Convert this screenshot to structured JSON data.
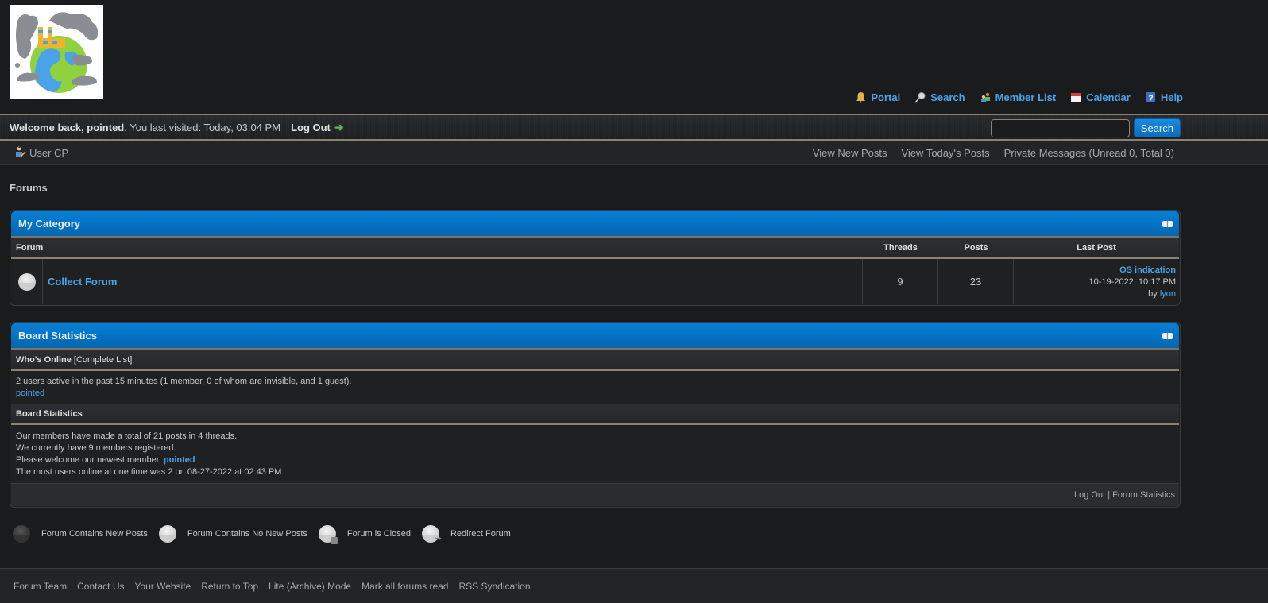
{
  "header": {
    "logo_alt": "earth-pollution-logo",
    "menu": [
      {
        "label": "Portal",
        "icon": "bell-icon"
      },
      {
        "label": "Search",
        "icon": "magnifier-icon"
      },
      {
        "label": "Member List",
        "icon": "members-icon"
      },
      {
        "label": "Calendar",
        "icon": "calendar-icon"
      },
      {
        "label": "Help",
        "icon": "help-icon"
      }
    ]
  },
  "welcome": {
    "greeting": "Welcome back, pointed",
    "last_visit": ". You last visited: Today, 03:04 PM",
    "logout_label": "Log Out",
    "search_placeholder": "",
    "search_value": "",
    "search_button": "Search"
  },
  "usercp": {
    "label": "User CP",
    "links": [
      "View New Posts",
      "View Today's Posts",
      "Private Messages (Unread 0, Total 0)"
    ]
  },
  "breadcrumb": "Forums",
  "category": {
    "title": "My Category",
    "columns": {
      "forum": "Forum",
      "threads": "Threads",
      "posts": "Posts",
      "last_post": "Last Post"
    },
    "forums": [
      {
        "name": "Collect Forum",
        "status": "no-new-posts",
        "threads": "9",
        "posts": "23",
        "last_post_title": "OS indication",
        "last_post_date": "10-19-2022, 10:17 PM",
        "last_post_by_prefix": "by ",
        "last_post_by": "lyon"
      }
    ]
  },
  "board_stats": {
    "title": "Board Statistics",
    "whos_online_label": "Who's Online",
    "complete_list_label": "[Complete List]",
    "online_text": "2 users active in the past 15 minutes (1 member, 0 of whom are invisible, and 1 guest).",
    "online_users": [
      "pointed"
    ],
    "stats_label": "Board Statistics",
    "stats_line1": "Our members have made a total of 21 posts in 4 threads.",
    "stats_line2": "We currently have 9 members registered.",
    "stats_line3_prefix": "Please welcome our newest member, ",
    "newest_member": "pointed",
    "stats_line4": "The most users online at one time was 2 on 08-27-2022 at 02:43 PM",
    "footer_logout": "Log Out",
    "footer_sep": " | ",
    "footer_stats": "Forum Statistics"
  },
  "legend": [
    {
      "label": "Forum Contains New Posts",
      "icon": "forum-new-posts-icon"
    },
    {
      "label": "Forum Contains No New Posts",
      "icon": "forum-no-new-posts-icon"
    },
    {
      "label": "Forum is Closed",
      "icon": "forum-closed-icon"
    },
    {
      "label": "Redirect Forum",
      "icon": "forum-redirect-icon"
    }
  ],
  "footer": {
    "links": [
      "Forum Team",
      "Contact Us",
      "Your Website",
      "Return to Top",
      "Lite (Archive) Mode",
      "Mark all forums read",
      "RSS Syndication"
    ]
  },
  "colors": {
    "accent": "#0580d8",
    "link": "#4aa3e8",
    "background": "#1a1b1d"
  }
}
